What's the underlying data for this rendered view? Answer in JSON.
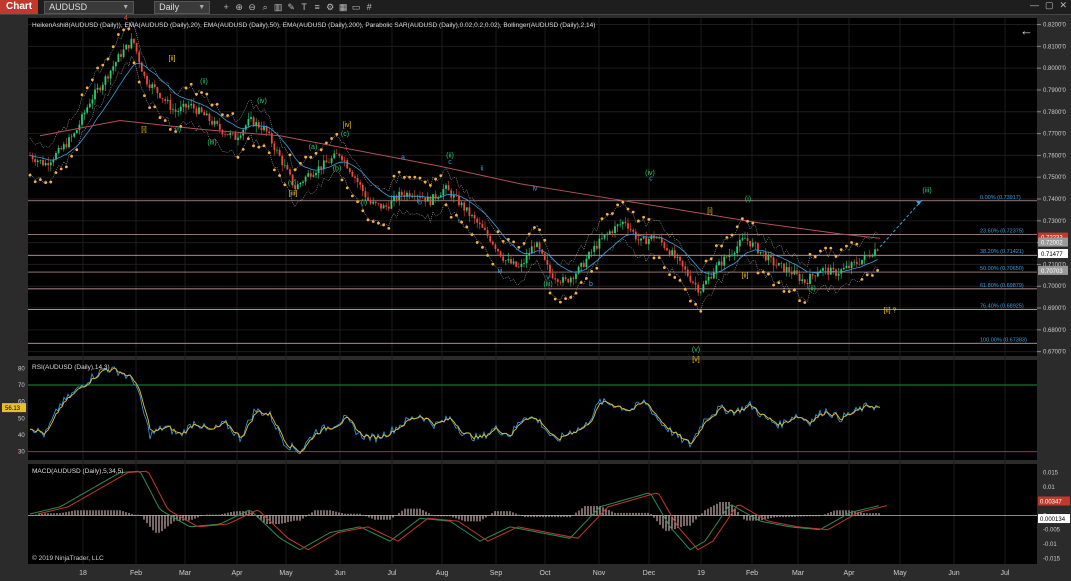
{
  "toolbar": {
    "chart_label": "Chart",
    "symbol": "AUDUSD",
    "period": "Daily",
    "buttons": [
      "crosshair-icon",
      "zoom-in-icon",
      "zoom-out-icon",
      "search-icon",
      "bars-icon",
      "pencil-icon",
      "text-icon",
      "list-icon",
      "gear-icon",
      "layout-icon",
      "screen-icon",
      "grid-icon"
    ],
    "window_controls": [
      "—",
      "▢",
      "✕"
    ]
  },
  "price_panel": {
    "indicator_label": "HeikenAshi8(AUDUSD (Daily)), EMA(AUDUSD (Daily),20), EMA(AUDUSD (Daily),50), EMA(AUDUSD (Daily),200), Parabolic SAR(AUDUSD (Daily),0.02,0.2,0.02), Bollinger(AUDUSD (Daily),2,14)",
    "y_ticks": [
      "0.8200'0",
      "0.8100'0",
      "0.8000'0",
      "0.7900'0",
      "0.7800'0",
      "0.7700'0",
      "0.7600'0",
      "0.7500'0",
      "0.7400'0",
      "0.7300'0",
      "0.7200'0",
      "0.7100'0",
      "0.7000'0",
      "0.6900'0",
      "0.6800'0",
      "0.6700'0"
    ],
    "ylim": [
      0.668,
      0.823
    ],
    "price_tags": [
      {
        "text": "0.72233",
        "value": 0.7223,
        "color": "#c0392b"
      },
      {
        "text": "0.72002",
        "value": 0.72,
        "color": "#9a9a9a"
      },
      {
        "text": "0.71477",
        "value": 0.71477,
        "color": "#ffffff"
      },
      {
        "text": "0.70703",
        "value": 0.70703,
        "color": "#9a9a9a"
      }
    ],
    "fib_levels": [
      {
        "text": "0.00% (0.73917)",
        "value": 0.73917
      },
      {
        "text": "23.60% (0.72375)",
        "value": 0.72375
      },
      {
        "text": "38.20% (0.71421)",
        "value": 0.71421
      },
      {
        "text": "50.00% (0.70650)",
        "value": 0.7065
      },
      {
        "text": "61.80% (0.69879)",
        "value": 0.69879
      },
      {
        "text": "76.40% (0.68925)",
        "value": 0.68925
      },
      {
        "text": "100.00% (0.67383)",
        "value": 0.67383
      }
    ],
    "wave_labels": [
      {
        "text": "4",
        "x": 126,
        "price": 0.822,
        "color": "#e74c3c"
      },
      {
        "text": "[ii]",
        "x": 172,
        "price": 0.8035,
        "color": "#f1c40f"
      },
      {
        "text": "[i]",
        "x": 144,
        "price": 0.771,
        "color": "#f1c40f"
      },
      {
        "text": "(ii)",
        "x": 204,
        "price": 0.793,
        "color": "#2ecc71"
      },
      {
        "text": "(i)",
        "x": 178,
        "price": 0.771,
        "color": "#2ecc71"
      },
      {
        "text": "(iii)",
        "x": 212,
        "price": 0.765,
        "color": "#2ecc71"
      },
      {
        "text": "(iv)",
        "x": 262,
        "price": 0.784,
        "color": "#2ecc71"
      },
      {
        "text": "(v)",
        "x": 292,
        "price": 0.7465,
        "color": "#2ecc71"
      },
      {
        "text": "[iii]",
        "x": 293,
        "price": 0.7415,
        "color": "#f1c40f"
      },
      {
        "text": "[iv]",
        "x": 347,
        "price": 0.773,
        "color": "#f1c40f"
      },
      {
        "text": "(c)",
        "x": 345,
        "price": 0.769,
        "color": "#2ecc71"
      },
      {
        "text": "(a)",
        "x": 313,
        "price": 0.763,
        "color": "#2ecc71"
      },
      {
        "text": "(b)",
        "x": 337,
        "price": 0.753,
        "color": "#2ecc71"
      },
      {
        "text": "(i)",
        "x": 364,
        "price": 0.7375,
        "color": "#2ecc71"
      },
      {
        "text": "a",
        "x": 403,
        "price": 0.758,
        "color": "#3aa0e0"
      },
      {
        "text": "b",
        "x": 420,
        "price": 0.7375,
        "color": "#3aa0e0"
      },
      {
        "text": "(ii)",
        "x": 450,
        "price": 0.759,
        "color": "#2ecc71"
      },
      {
        "text": "c",
        "x": 450,
        "price": 0.756,
        "color": "#3aa0e0"
      },
      {
        "text": "ii",
        "x": 482,
        "price": 0.753,
        "color": "#3aa0e0"
      },
      {
        "text": "i",
        "x": 459,
        "price": 0.729,
        "color": "#3aa0e0"
      },
      {
        "text": "iv",
        "x": 535,
        "price": 0.744,
        "color": "#3aa0e0"
      },
      {
        "text": "iii",
        "x": 500,
        "price": 0.706,
        "color": "#3aa0e0"
      },
      {
        "text": "v",
        "x": 548,
        "price": 0.703,
        "color": "#3aa0e0"
      },
      {
        "text": "(iii)",
        "x": 548,
        "price": 0.7,
        "color": "#2ecc71"
      },
      {
        "text": "b",
        "x": 591,
        "price": 0.7,
        "color": "#3aa0e0"
      },
      {
        "text": "(iv)",
        "x": 650,
        "price": 0.751,
        "color": "#2ecc71"
      },
      {
        "text": "c",
        "x": 651,
        "price": 0.7485,
        "color": "#3aa0e0"
      },
      {
        "text": "(v)",
        "x": 696,
        "price": 0.67,
        "color": "#2ecc71"
      },
      {
        "text": "[v]",
        "x": 696,
        "price": 0.6655,
        "color": "#f1c40f"
      },
      {
        "text": "[i]",
        "x": 710,
        "price": 0.7335,
        "color": "#f1c40f"
      },
      {
        "text": "(i)",
        "x": 748,
        "price": 0.739,
        "color": "#2ecc71"
      },
      {
        "text": "[ii]",
        "x": 745,
        "price": 0.704,
        "color": "#f1c40f"
      },
      {
        "text": "(ii)",
        "x": 812,
        "price": 0.698,
        "color": "#2ecc71"
      },
      {
        "text": "(iii)",
        "x": 927,
        "price": 0.743,
        "color": "#2ecc71"
      },
      {
        "text": "[ii] ?",
        "x": 890,
        "price": 0.688,
        "color": "#f1c40f"
      }
    ],
    "projection": {
      "from": [
        880,
        0.718
      ],
      "to": [
        922,
        0.7395
      ]
    }
  },
  "rsi_panel": {
    "label": "RSI(AUDUSD (Daily),14,3)",
    "y_ticks": [
      "80",
      "70",
      "60",
      "50",
      "40",
      "30"
    ],
    "ylim": [
      25,
      85
    ],
    "current_tag": "56.13",
    "current_value": 56.13
  },
  "macd_panel": {
    "label": "MACD(AUDUSD (Daily),5,34,5)",
    "y_ticks": [
      "0.015",
      "0.01",
      "0.005",
      "0",
      "-0.005",
      "-0.01",
      "-0.015"
    ],
    "ylim": [
      -0.017,
      0.018
    ],
    "tags": [
      {
        "text": "0.00347",
        "value": 0.00347,
        "color": "#c0392b"
      },
      {
        "text": "0.000134",
        "value": 0.000134,
        "color": "#ffffff"
      }
    ],
    "copyright": "© 2019 NinjaTrader, LLC"
  },
  "x_axis": {
    "ticks": [
      {
        "label": "18",
        "x": 83
      },
      {
        "label": "Feb",
        "x": 136
      },
      {
        "label": "Mar",
        "x": 185
      },
      {
        "label": "Apr",
        "x": 237
      },
      {
        "label": "May",
        "x": 286
      },
      {
        "label": "Jun",
        "x": 340
      },
      {
        "label": "Jul",
        "x": 392
      },
      {
        "label": "Aug",
        "x": 442
      },
      {
        "label": "Sep",
        "x": 496
      },
      {
        "label": "Oct",
        "x": 545
      },
      {
        "label": "Nov",
        "x": 599
      },
      {
        "label": "Dec",
        "x": 649
      },
      {
        "label": "19",
        "x": 701
      },
      {
        "label": "Feb",
        "x": 752
      },
      {
        "label": "Mar",
        "x": 798
      },
      {
        "label": "Apr",
        "x": 849
      },
      {
        "label": "May",
        "x": 900
      },
      {
        "label": "Jun",
        "x": 954
      },
      {
        "label": "Jul",
        "x": 1005
      }
    ]
  },
  "colors": {
    "up_candle": "#2ecc71",
    "down_candle": "#e74c3c",
    "psar": "#f5b041",
    "ema20": "#3a9bdc",
    "ema200": "#b0505a",
    "bollinger": "#cfcfcf",
    "rsi": "#e6c02a",
    "rsi_signal": "#3aa0e0",
    "macd": "#2e8b57",
    "macd_signal": "#c0392b"
  },
  "chart_data": {
    "type": "line",
    "title": "",
    "symbol": "AUDUSD",
    "timeframe": "Daily",
    "series": [
      {
        "name": "",
        "x": [
          30,
          45,
          60,
          75,
          90,
          105,
          120,
          133,
          145,
          160,
          175,
          190,
          205,
          220,
          235,
          250,
          265,
          280,
          295,
          310,
          325,
          340,
          355,
          370,
          385,
          400,
          415,
          430,
          445,
          460,
          475,
          490,
          505,
          520,
          535,
          550,
          565,
          580,
          595,
          610,
          625,
          640,
          655,
          670,
          685,
          700,
          715,
          730,
          745,
          760,
          775,
          790,
          805,
          820,
          835,
          850,
          865,
          878
        ],
        "values": [
          0.76,
          0.756,
          0.762,
          0.77,
          0.785,
          0.795,
          0.806,
          0.813,
          0.795,
          0.788,
          0.78,
          0.783,
          0.778,
          0.772,
          0.768,
          0.776,
          0.772,
          0.759,
          0.745,
          0.752,
          0.756,
          0.761,
          0.75,
          0.738,
          0.736,
          0.742,
          0.743,
          0.739,
          0.745,
          0.738,
          0.73,
          0.722,
          0.712,
          0.708,
          0.72,
          0.706,
          0.702,
          0.708,
          0.718,
          0.725,
          0.73,
          0.72,
          0.723,
          0.716,
          0.707,
          0.698,
          0.708,
          0.715,
          0.722,
          0.716,
          0.71,
          0.707,
          0.702,
          0.708,
          0.706,
          0.709,
          0.713,
          0.718
        ]
      }
    ],
    "ema200": {
      "x": [
        40,
        120,
        200,
        280,
        360,
        440,
        520,
        600,
        680,
        760,
        840,
        880
      ],
      "values": [
        0.769,
        0.776,
        0.772,
        0.769,
        0.762,
        0.755,
        0.747,
        0.741,
        0.735,
        0.729,
        0.724,
        0.722
      ]
    },
    "rsi": {
      "x": [
        30,
        45,
        60,
        75,
        90,
        105,
        120,
        135,
        150,
        165,
        180,
        195,
        210,
        225,
        240,
        255,
        270,
        285,
        300,
        315,
        330,
        345,
        360,
        375,
        390,
        405,
        420,
        435,
        450,
        465,
        480,
        495,
        510,
        525,
        540,
        555,
        570,
        585,
        600,
        615,
        630,
        645,
        660,
        675,
        690,
        705,
        720,
        735,
        750,
        765,
        780,
        795,
        810,
        825,
        840,
        855,
        870,
        880
      ],
      "values": [
        45,
        40,
        58,
        66,
        74,
        80,
        78,
        72,
        40,
        45,
        40,
        48,
        42,
        47,
        38,
        55,
        52,
        35,
        30,
        42,
        45,
        50,
        40,
        38,
        42,
        48,
        52,
        46,
        50,
        40,
        38,
        44,
        40,
        52,
        48,
        36,
        42,
        45,
        60,
        58,
        55,
        60,
        48,
        40,
        34,
        50,
        56,
        54,
        58,
        50,
        46,
        52,
        48,
        55,
        50,
        54,
        58,
        56
      ]
    },
    "macd": {
      "x": [
        30,
        60,
        90,
        120,
        140,
        160,
        190,
        220,
        250,
        280,
        300,
        330,
        360,
        390,
        420,
        450,
        480,
        510,
        540,
        570,
        600,
        630,
        650,
        670,
        690,
        705,
        730,
        760,
        790,
        820,
        850,
        880
      ],
      "values": [
        0.0005,
        0.003,
        0.009,
        0.015,
        0.0155,
        0.002,
        -0.004,
        -0.003,
        0.002,
        -0.008,
        -0.012,
        -0.006,
        -0.004,
        -0.009,
        -0.001,
        -0.002,
        -0.009,
        -0.004,
        -0.006,
        -0.008,
        0.003,
        0.006,
        0.008,
        -0.004,
        -0.012,
        -0.009,
        0.004,
        -0.002,
        -0.004,
        -0.005,
        0.001,
        0.0035
      ]
    }
  }
}
